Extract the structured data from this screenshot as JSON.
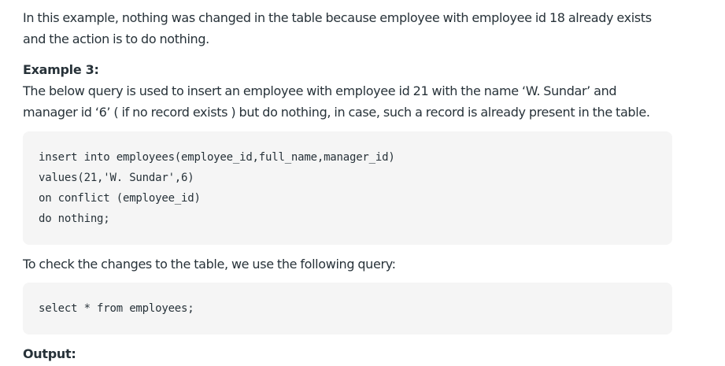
{
  "article": {
    "intro": "In this example, nothing was changed in the table because employee with employee id 18 already exists and the action is to do nothing.",
    "example_heading": "Example 3:",
    "description": "The below query is used to insert an employee with employee id 21 with the name ‘W. Sundar’ and manager id ‘6’ ( if no record exists ) but do nothing, in case, such a record is already present in the table.",
    "code_block_1": [
      "insert into employees(employee_id,full_name,manager_id)",
      "values(21,'W. Sundar',6)",
      "on conflict (employee_id)",
      "do nothing;"
    ],
    "check_text": "To check the changes to the table, we use the following query:",
    "code_block_2": [
      "select * from employees;"
    ],
    "output_heading": "Output:"
  }
}
